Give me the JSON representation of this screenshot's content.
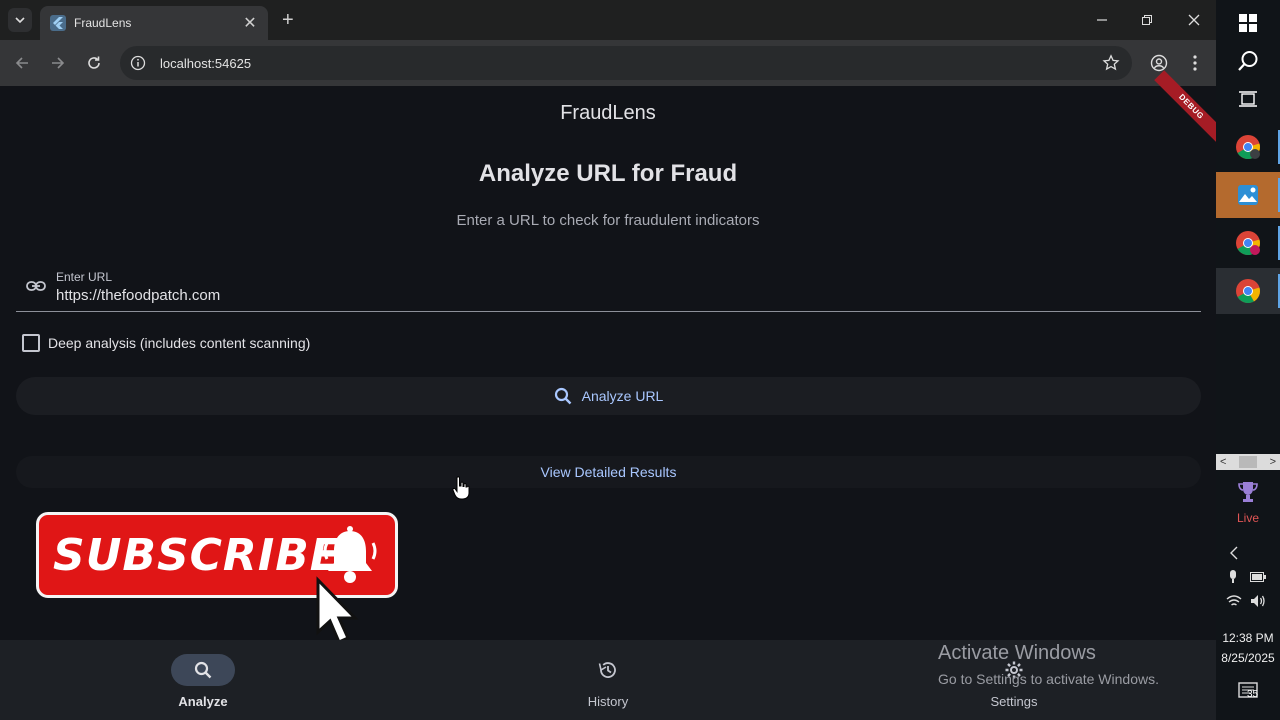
{
  "browser": {
    "tab_title": "FraudLens",
    "url": "localhost:54625"
  },
  "app": {
    "title": "FraudLens",
    "debug_banner": "DEBUG",
    "heading": "Analyze URL for Fraud",
    "subheading": "Enter a URL to check for fraudulent indicators",
    "url_field": {
      "label": "Enter URL",
      "value": "https://thefoodpatch.com"
    },
    "deep_analysis": {
      "label": "Deep analysis (includes content scanning)",
      "checked": false
    },
    "analyze_button": "Analyze URL",
    "view_results_button": "View Detailed Results",
    "nav": [
      {
        "label": "Analyze",
        "icon": "search-icon",
        "active": true
      },
      {
        "label": "History",
        "icon": "history-icon",
        "active": false
      },
      {
        "label": "Settings",
        "icon": "gear-icon",
        "active": false
      }
    ]
  },
  "overlay": {
    "subscribe_text": "SUBSCRIBE",
    "watermark_title": "Activate Windows",
    "watermark_sub": "Go to Settings to activate Windows."
  },
  "taskbar": {
    "live_label": "Live",
    "time": "12:38 PM",
    "date": "8/25/2025",
    "notification_count": "35"
  },
  "colors": {
    "background": "#111318",
    "accent": "#a9c7ff",
    "subscribe_red": "#e01616",
    "debug_red": "#a51c25"
  }
}
